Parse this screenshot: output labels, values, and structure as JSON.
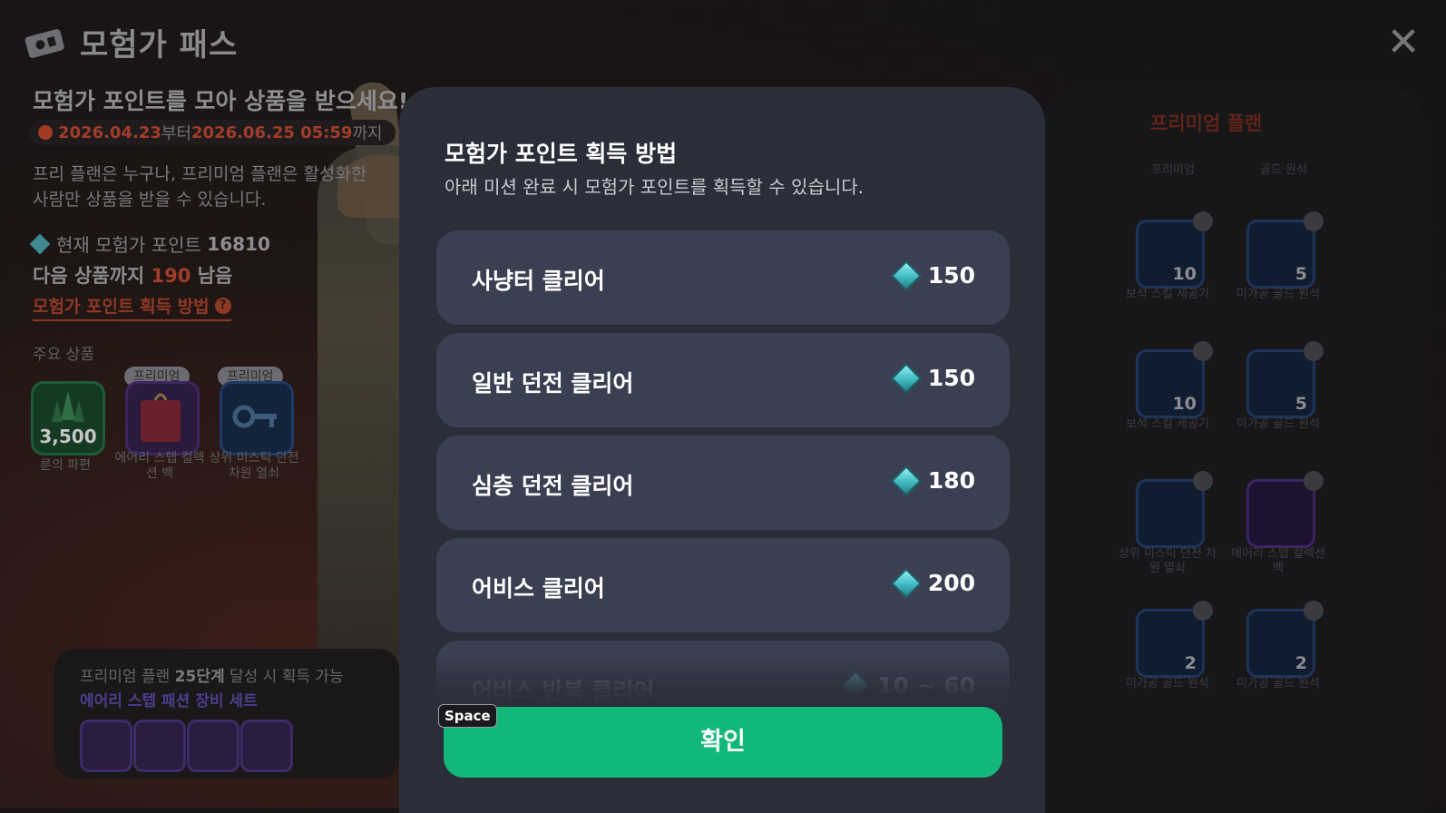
{
  "header": {
    "title": "모험가 패스",
    "close_label": "✕"
  },
  "left": {
    "headline": "모험가 포인트를 모아 상품을 받으세요!",
    "period": {
      "start": "2026.04.23",
      "from": "부터",
      "end": "2026.06.25 05:59",
      "until": "까지"
    },
    "description": "프리 플랜은 누구나, 프리미엄 플랜은 활성화한 사람만 상품을 받을 수 있습니다.",
    "points_label": "현재 모험가 포인트",
    "points_value": "16810",
    "next_prefix": "다음 상품까지",
    "next_value": "190",
    "next_suffix": "남음",
    "howto_link": "모험가 포인트 획득 방법",
    "help_glyph": "?",
    "featured_label": "주요 상품",
    "featured": [
      {
        "name": "룬의 파편",
        "qty": "3,500",
        "tag": ""
      },
      {
        "name": "에어리 스텝 컬렉션 백",
        "qty": "",
        "tag": "프리미엄"
      },
      {
        "name": "상위 미스틱 던전 차원 열쇠",
        "qty": "",
        "tag": "프리미엄"
      }
    ],
    "reward": {
      "prefix": "프리미엄 플랜",
      "level": "25단계",
      "suffix": "달성 시 획득 가능",
      "set_name": "에어리 스텝 패션 장비 세트"
    }
  },
  "right": {
    "title": "프리미엄 플랜",
    "top_captions": [
      "프리미엄",
      "골드 원석"
    ],
    "items": [
      {
        "label": "보석 스킬 세공기",
        "qty": "10"
      },
      {
        "label": "미가공 골드 원석",
        "qty": "5"
      },
      {
        "label": "보석 스킬 세공기",
        "qty": "10"
      },
      {
        "label": "미가공 골드 원석",
        "qty": "5"
      },
      {
        "label": "상위 미스틱 던전 차원 열쇠",
        "qty": ""
      },
      {
        "label": "에어리 스텝 컬렉션 백",
        "qty": ""
      },
      {
        "label": "미가공 골드 원석",
        "qty": "2"
      },
      {
        "label": "미가공 골드 원석",
        "qty": "2"
      }
    ]
  },
  "modal": {
    "title": "모험가 포인트 획득 방법",
    "subtitle": "아래 미션 완료 시 모험가 포인트를 획득할 수 있습니다.",
    "missions": [
      {
        "label": "사냥터 클리어",
        "points": "150"
      },
      {
        "label": "일반 던전 클리어",
        "points": "150"
      },
      {
        "label": "심층 던전 클리어",
        "points": "180"
      },
      {
        "label": "어비스 클리어",
        "points": "200"
      },
      {
        "label": "어비스 반복 클리어",
        "points": "10 ~ 60"
      }
    ],
    "confirm_label": "확인",
    "hotkey": "Space"
  },
  "colors": {
    "confirm": "#12b77a",
    "accent_orange": "#a03c28",
    "modal_bg": "#2b2d38",
    "row_bg": "#3b3f52"
  }
}
